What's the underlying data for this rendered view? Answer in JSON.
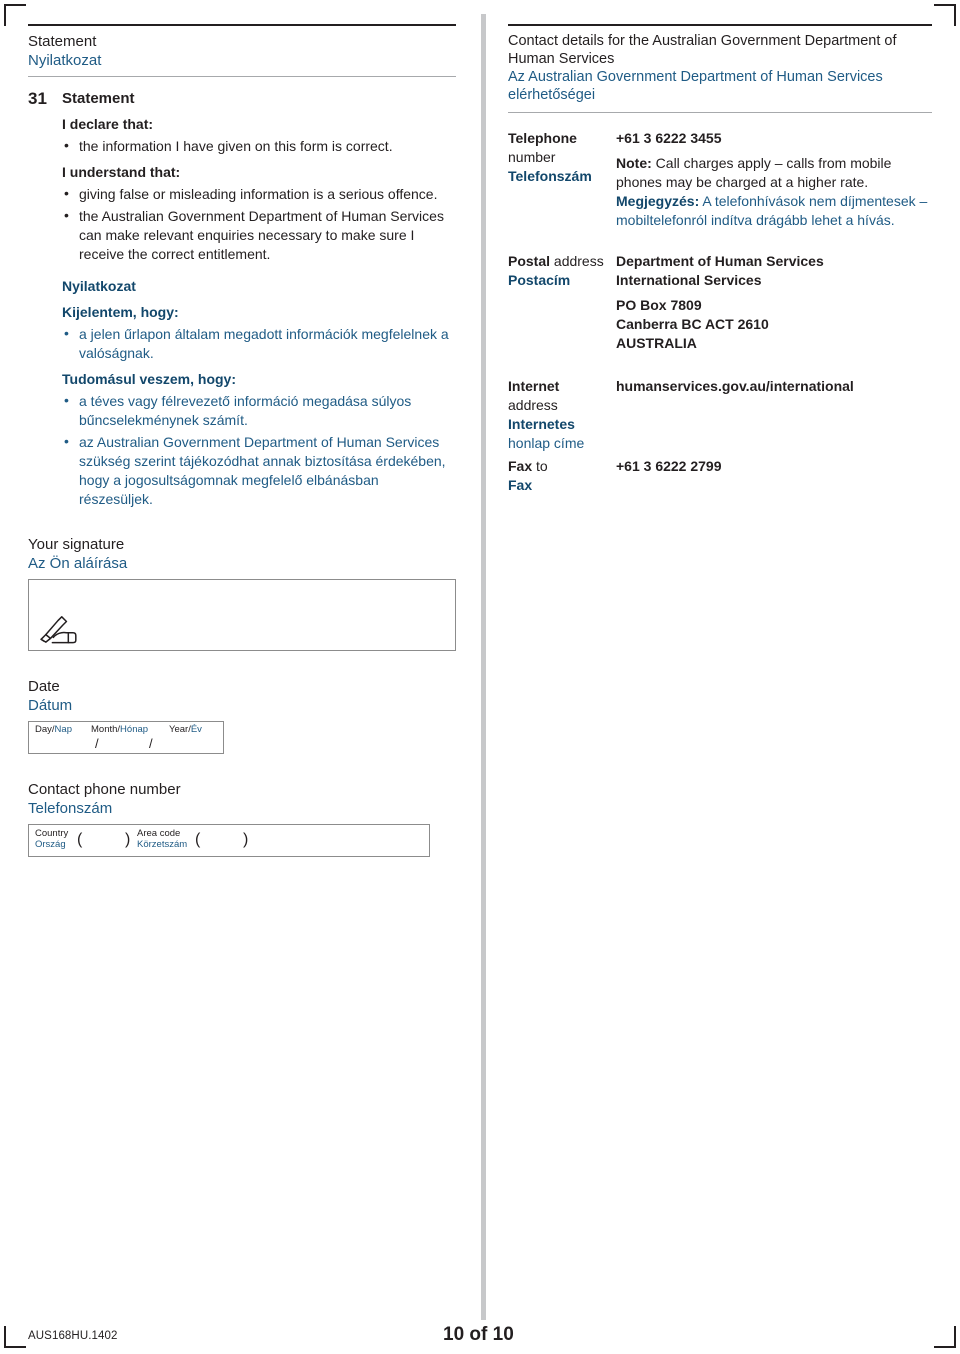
{
  "page": {
    "footer_code": "AUS168HU.1402",
    "page_number": "10 of 10"
  },
  "left_column": {
    "section_header": {
      "en": "Statement",
      "hu": "Nyilatkozat"
    },
    "question": {
      "number": "31",
      "title_en": "Statement",
      "declare_heading_en": "I declare that:",
      "declare_bullets_en": [
        "the information I have given on this form is correct."
      ],
      "understand_heading_en": "I understand that:",
      "understand_bullets_en": [
        "giving false or misleading information is a serious offence.",
        "the Australian Government Department of Human Services can make relevant enquiries necessary to make sure I receive the correct entitlement."
      ],
      "title_hu": "Nyilatkozat",
      "declare_heading_hu": "Kijelentem, hogy:",
      "declare_bullets_hu": [
        "a jelen űrlapon általam megadott információk megfelelnek a valóságnak."
      ],
      "understand_heading_hu": "Tudomásul veszem, hogy:",
      "understand_bullets_hu": [
        "a téves vagy félrevezető információ megadása súlyos bűncselekménynek számít.",
        "az Australian Government Department of Human Services szükség szerint tájékozódhat annak biztosítása érdekében, hogy a jogosultságomnak megfelelő elbánásban részesüljek."
      ]
    },
    "signature": {
      "label_en": "Your signature",
      "label_hu": "Az Ön aláírása",
      "icon": "signing-hand-icon"
    },
    "date": {
      "label_en": "Date",
      "label_hu": "Dátum",
      "day_en": "Day/",
      "day_hu": "Nap",
      "month_en": "Month/",
      "month_hu": "Hónap",
      "year_en": "Year/",
      "year_hu": "Év",
      "separator": "/",
      "day_value": "",
      "month_value": "",
      "year_value": ""
    },
    "phone": {
      "label_en": "Contact phone number",
      "label_hu": "Telefonszám",
      "country_en": "Country",
      "country_hu": "Ország",
      "area_en": "Area code",
      "area_hu": "Körzetszám",
      "paren_open": "(",
      "paren_close": ")",
      "country_value": "",
      "area_value": "",
      "number_value": ""
    }
  },
  "right_column": {
    "header": {
      "en": "Contact details for the Australian Government Department of Human Services",
      "hu": "Az Australian Government Department of Human Services elérhetőségei"
    },
    "rows": [
      {
        "key_bold": "Telephone",
        "key_plain": "number",
        "key_hu": "Telefonszám",
        "value_primary": "+61 3 6222 3455",
        "note_label_en": "Note:",
        "note_text_en": " Call charges apply – calls from mobile phones may be charged at a higher rate.",
        "note_label_hu": "Megjegyzés:",
        "note_text_hu": " A telefonhívások nem díjmentesek – mobiltelefonról indítva drágább lehet a hívás."
      },
      {
        "key_bold": "Postal",
        "key_plain": "address",
        "key_hu": "Postacím",
        "value_line1": "Department of Human Services",
        "value_line2": "International Services",
        "value_line3": "PO Box 7809",
        "value_line4": "Canberra BC ACT 2610",
        "value_line5": "AUSTRALIA"
      },
      {
        "key_bold": "Internet",
        "key_plain": "address",
        "key_hu_bold": "Internetes",
        "key_hu_plain": "honlap címe",
        "value_primary": "humanservices.gov.au/international"
      },
      {
        "key_bold": "Fax",
        "key_plain": "to",
        "key_hu": "Fax",
        "value_primary": "+61 3 6222 2799"
      }
    ]
  },
  "colors": {
    "hungarian_text": "#1f5b85",
    "hungarian_bold": "#12476b",
    "english_text": "#231f20",
    "divider_gray": "#c7c8ca"
  }
}
